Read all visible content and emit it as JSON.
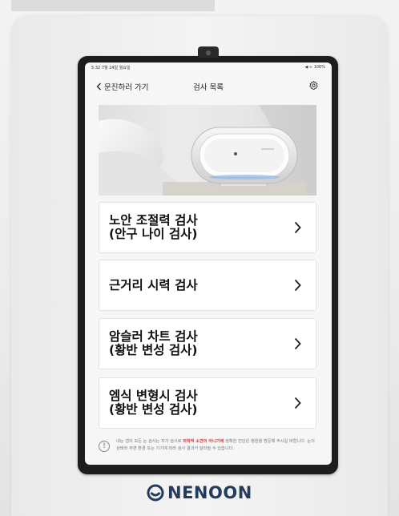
{
  "status_bar": {
    "time_date": "5:32  7월 24일 월요일",
    "signal": "◀ ≈ 100%"
  },
  "nav": {
    "back_label": "문진하러 가기",
    "title": "검사 목록"
  },
  "menu": [
    {
      "label": "노안 조절력 검사\n(안구 나이 검사)"
    },
    {
      "label": "근거리 시력 검사"
    },
    {
      "label": "암슬러 차트 검사\n(황반 변성 검사)"
    },
    {
      "label": "엠식 변형시 검사\n(황반 변성 검사)"
    }
  ],
  "notice": {
    "before": "내눈 앱의 모든 눈 검사는 자가 검사로 ",
    "highlight": "의학적 소견이 아니기에",
    "after": " 정확한 진단은 병원을 방문해 주시길 바랍니다. 눈의 상태와 주변 환경 또는 기기에 따라 검사 결과가 달라질 수 있습니다."
  },
  "brand": {
    "name": "NENOON",
    "color": "#223b5e"
  }
}
